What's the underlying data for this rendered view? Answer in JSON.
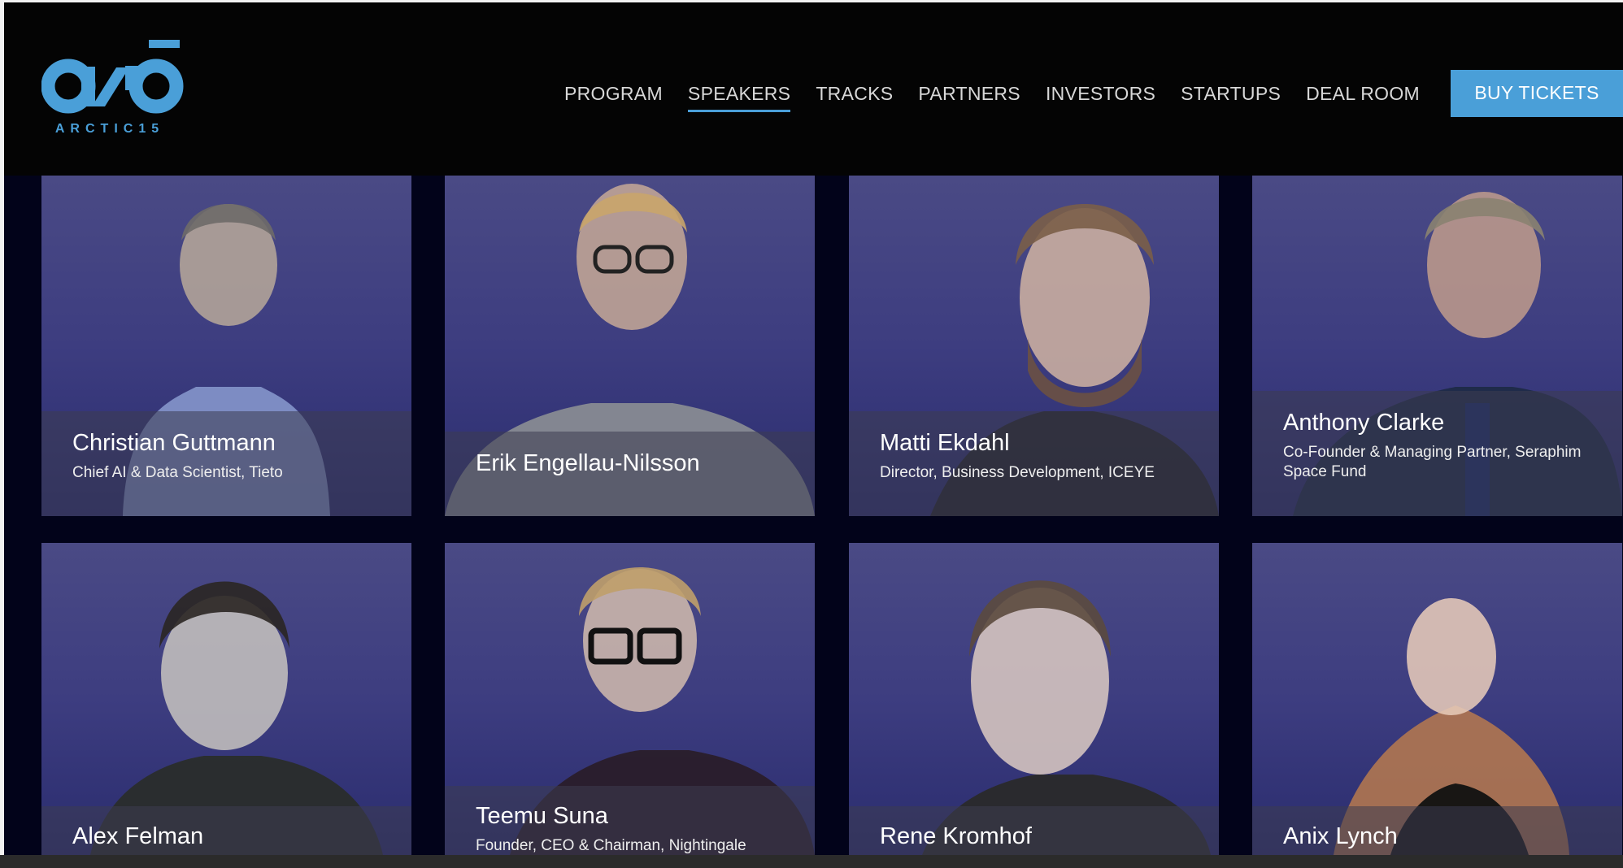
{
  "brand": {
    "logo_text": "ARCTIC15",
    "accent_color": "#4a9fd8"
  },
  "nav": {
    "items": [
      {
        "label": "PROGRAM",
        "active": false
      },
      {
        "label": "SPEAKERS",
        "active": true
      },
      {
        "label": "TRACKS",
        "active": false
      },
      {
        "label": "PARTNERS",
        "active": false
      },
      {
        "label": "INVESTORS",
        "active": false
      },
      {
        "label": "STARTUPS",
        "active": false
      },
      {
        "label": "DEAL ROOM",
        "active": false
      }
    ],
    "cta_label": "BUY TICKETS"
  },
  "speakers": [
    {
      "name": "Christian Guttmann",
      "title": "Chief AI & Data Scientist, Tieto"
    },
    {
      "name": "Erik Engellau-Nilsson",
      "title": ""
    },
    {
      "name": "Matti Ekdahl",
      "title": "Director, Business Development, ICEYE"
    },
    {
      "name": "Anthony Clarke",
      "title": "Co-Founder & Managing Partner, Seraphim Space Fund"
    },
    {
      "name": "Alex Felman",
      "title": ""
    },
    {
      "name": "Teemu Suna",
      "title": "Founder, CEO & Chairman, Nightingale"
    },
    {
      "name": "Rene Kromhof",
      "title": ""
    },
    {
      "name": "Anix Lynch",
      "title": ""
    }
  ]
}
